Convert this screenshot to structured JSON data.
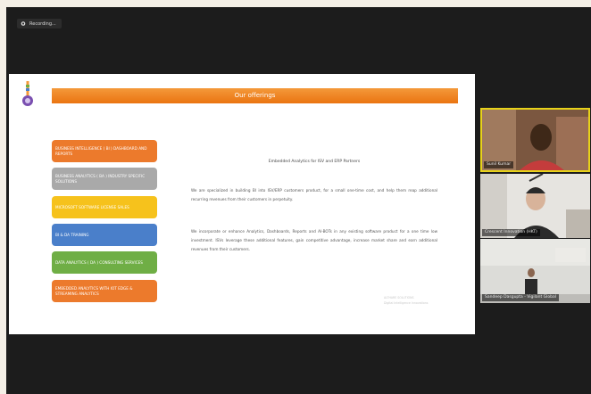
{
  "recording": {
    "label": "Recording..."
  },
  "slide": {
    "banner_title": "Our offerings",
    "offerings": [
      {
        "label": "BUSINESS INTELLIGENCE ( BI ) DASHBOARD AND REPORTS",
        "color": "#ec7a2c"
      },
      {
        "label": "BUSINESS ANALYTICS ( BA ) INDUSTRY SPECIFIC SOLUTIONS",
        "color": "#a9a9a9"
      },
      {
        "label": "MICROSOFT SOFTWARE LICENSE SALES",
        "color": "#f6c21c"
      },
      {
        "label": "BI & DA TRAINING",
        "color": "#4a7fca"
      },
      {
        "label": "DATA ANALYTICS ( DA ) CONSULTING SERVICES",
        "color": "#6fae45"
      },
      {
        "label": "EMBEDDED ANALYTICS WITH IOT EDGE & STREAMING ANALYTICS",
        "color": "#ec7a2c"
      }
    ],
    "content_title": "Embedded Analytics for ISV and ERP Partners",
    "paragraphs": [
      "We are specialized in building BI into ISV/ERP customers product, for a small one-time cost, and help them reap additional recurring revenues from their customers in perpetuity.",
      "We incorporate or enhance Analytics, Dashboards, Reports and AI-BOTs in any existing software product for a one time low investment. ISVs leverage these additional features, gain competitive advantage, increase market share and earn additional revenues from their customers."
    ],
    "footer_lines": [
      "ALTHARE SOLUTIONS",
      "Digital Intelligence Innovations"
    ]
  },
  "participants": [
    {
      "name": "Sunil Kumar",
      "active": true,
      "bg": "#8a5b3b"
    },
    {
      "name": "Crescent Innovation (HKT)",
      "active": false,
      "bg": "#e5e3df"
    },
    {
      "name": "Sandeep Dasgupta - Vigilant Global",
      "active": false,
      "bg": "#d8d8d4"
    }
  ]
}
